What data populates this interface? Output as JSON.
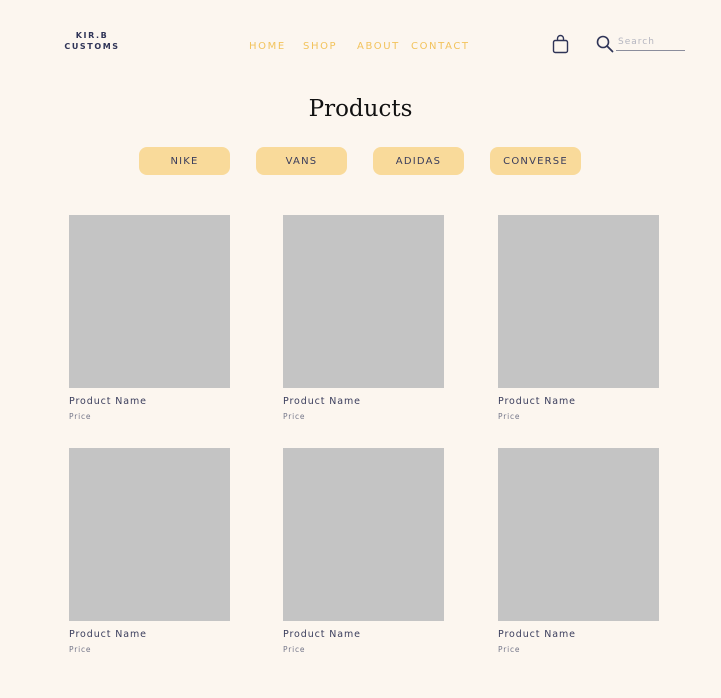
{
  "brand": {
    "line1": "KIR.B",
    "line2": "CUSTOMS"
  },
  "nav": [
    {
      "label": "HOME"
    },
    {
      "label": "SHOP"
    },
    {
      "label": "ABOUT"
    },
    {
      "label": "CONTACT"
    }
  ],
  "search": {
    "placeholder": "Search",
    "value": ""
  },
  "icons": {
    "cart": "shopping-bag-icon",
    "search": "search-icon"
  },
  "page": {
    "title": "Products"
  },
  "filters": [
    {
      "label": "NIKE"
    },
    {
      "label": "VANS"
    },
    {
      "label": "ADIDAS"
    },
    {
      "label": "CONVERSE"
    }
  ],
  "products": [
    {
      "name": "Product Name",
      "price": "Price"
    },
    {
      "name": "Product Name",
      "price": "Price"
    },
    {
      "name": "Product Name",
      "price": "Price"
    },
    {
      "name": "Product Name",
      "price": "Price"
    },
    {
      "name": "Product Name",
      "price": "Price"
    },
    {
      "name": "Product Name",
      "price": "Price"
    }
  ],
  "colors": {
    "background": "#fcf6ef",
    "accent": "#f2c35c",
    "filter_pill": "#f9da9a",
    "text_dark": "#2f3457",
    "image_placeholder": "#c4c4c4"
  }
}
